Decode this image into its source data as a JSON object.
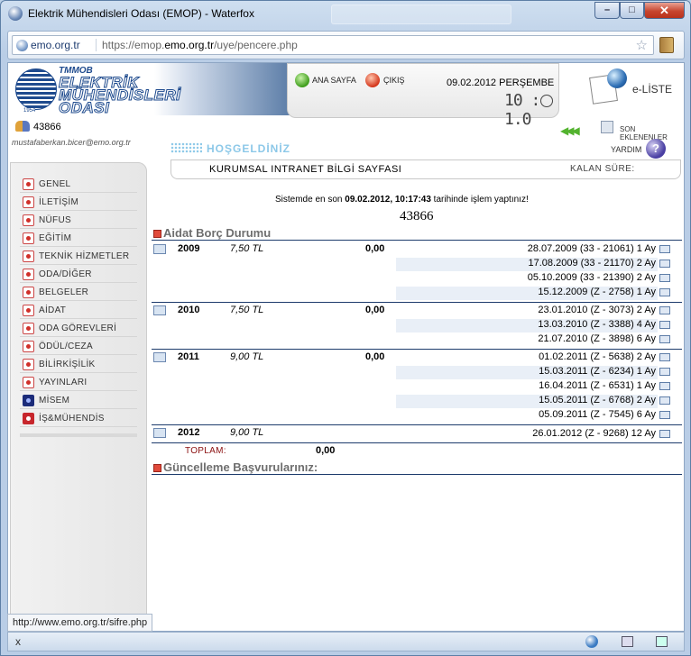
{
  "window": {
    "title": "Elektrik Mühendisleri Odası (EMOP) - Waterfox",
    "min": "–",
    "max": "□",
    "close": "✕"
  },
  "address": {
    "domain": "emo.org.tr",
    "url_prefix": "https://emop.",
    "url_host": "emo.org.tr",
    "url_path": "/uye/pencere.php"
  },
  "header": {
    "logo": {
      "tmmob": "TMMOB",
      "line1": "ELEKTRİK",
      "line2": "MÜHENDİSLERİ",
      "line3": "ODASI",
      "year": "1954"
    },
    "home": "ANA SAYFA",
    "exit": "ÇIKIŞ",
    "date": "09.02.2012 PERŞEMBE",
    "clock": "10 : 1.0",
    "eliste": "e-LİSTE",
    "member_no": "43866",
    "email": "mustafaberkan.bicer@emo.org.tr",
    "arrows": "◀◀◀",
    "son_eklenenler": "SON EKLENENLER",
    "welcome": "HOŞGELDİNİZ",
    "help": "YARDIM",
    "help_glyph": "?",
    "intranet": "KURUMSAL INTRANET BİLGİ SAYFASI",
    "kalan": "KALAN SÜRE:"
  },
  "sidebar": {
    "items": [
      {
        "label": "GENEL"
      },
      {
        "label": "İLETİŞİM"
      },
      {
        "label": "NÜFUS"
      },
      {
        "label": "EĞİTİM"
      },
      {
        "label": "TEKNİK HİZMETLER"
      },
      {
        "label": "ODA/DİĞER"
      },
      {
        "label": "BELGELER"
      },
      {
        "label": "AİDAT"
      },
      {
        "label": "ODA GÖREVLERİ"
      },
      {
        "label": "ÖDÜL/CEZA"
      },
      {
        "label": "BİLİRKİŞİLİK"
      },
      {
        "label": "YAYINLARI"
      },
      {
        "label": "MİSEM"
      },
      {
        "label": "İŞ&MÜHENDİS"
      }
    ]
  },
  "main": {
    "lastop_pre": "Sistemde en son ",
    "lastop_bold": "09.02.2012, 10:17:43",
    "lastop_post": " tarihinde işlem yaptınız!",
    "member_no": "43866",
    "dues_title": "Aidat Borç Durumu",
    "years": [
      {
        "year": "2009",
        "amount": "7,50 TL",
        "balance": "0,00",
        "payments": [
          "28.07.2009 (33 - 21061) 1 Ay",
          "17.08.2009 (33 - 21170) 2 Ay",
          "05.10.2009 (33 - 21390) 2 Ay",
          "15.12.2009 (Z - 2758) 1 Ay"
        ]
      },
      {
        "year": "2010",
        "amount": "7,50 TL",
        "balance": "0,00",
        "payments": [
          "23.01.2010 (Z - 3073) 2 Ay",
          "13.03.2010 (Z - 3388) 4 Ay",
          "21.07.2010 (Z - 3898) 6 Ay"
        ]
      },
      {
        "year": "2011",
        "amount": "9,00 TL",
        "balance": "0,00",
        "payments": [
          "01.02.2011 (Z - 5638) 2 Ay",
          "15.03.2011 (Z - 6234) 1 Ay",
          "16.04.2011 (Z - 6531) 1 Ay",
          "15.05.2011 (Z - 6768) 2 Ay",
          "05.09.2011 (Z - 7545) 6 Ay"
        ]
      },
      {
        "year": "2012",
        "amount": "9,00 TL",
        "balance": "",
        "payments": [
          "26.01.2012 (Z - 9268) 12 Ay"
        ]
      }
    ],
    "total_label": "TOPLAM:",
    "total_value": "0,00",
    "updates_title": "Güncelleme Başvurularınız:"
  },
  "status": {
    "url": "http://www.emo.org.tr/sifre.php",
    "close": "x"
  }
}
